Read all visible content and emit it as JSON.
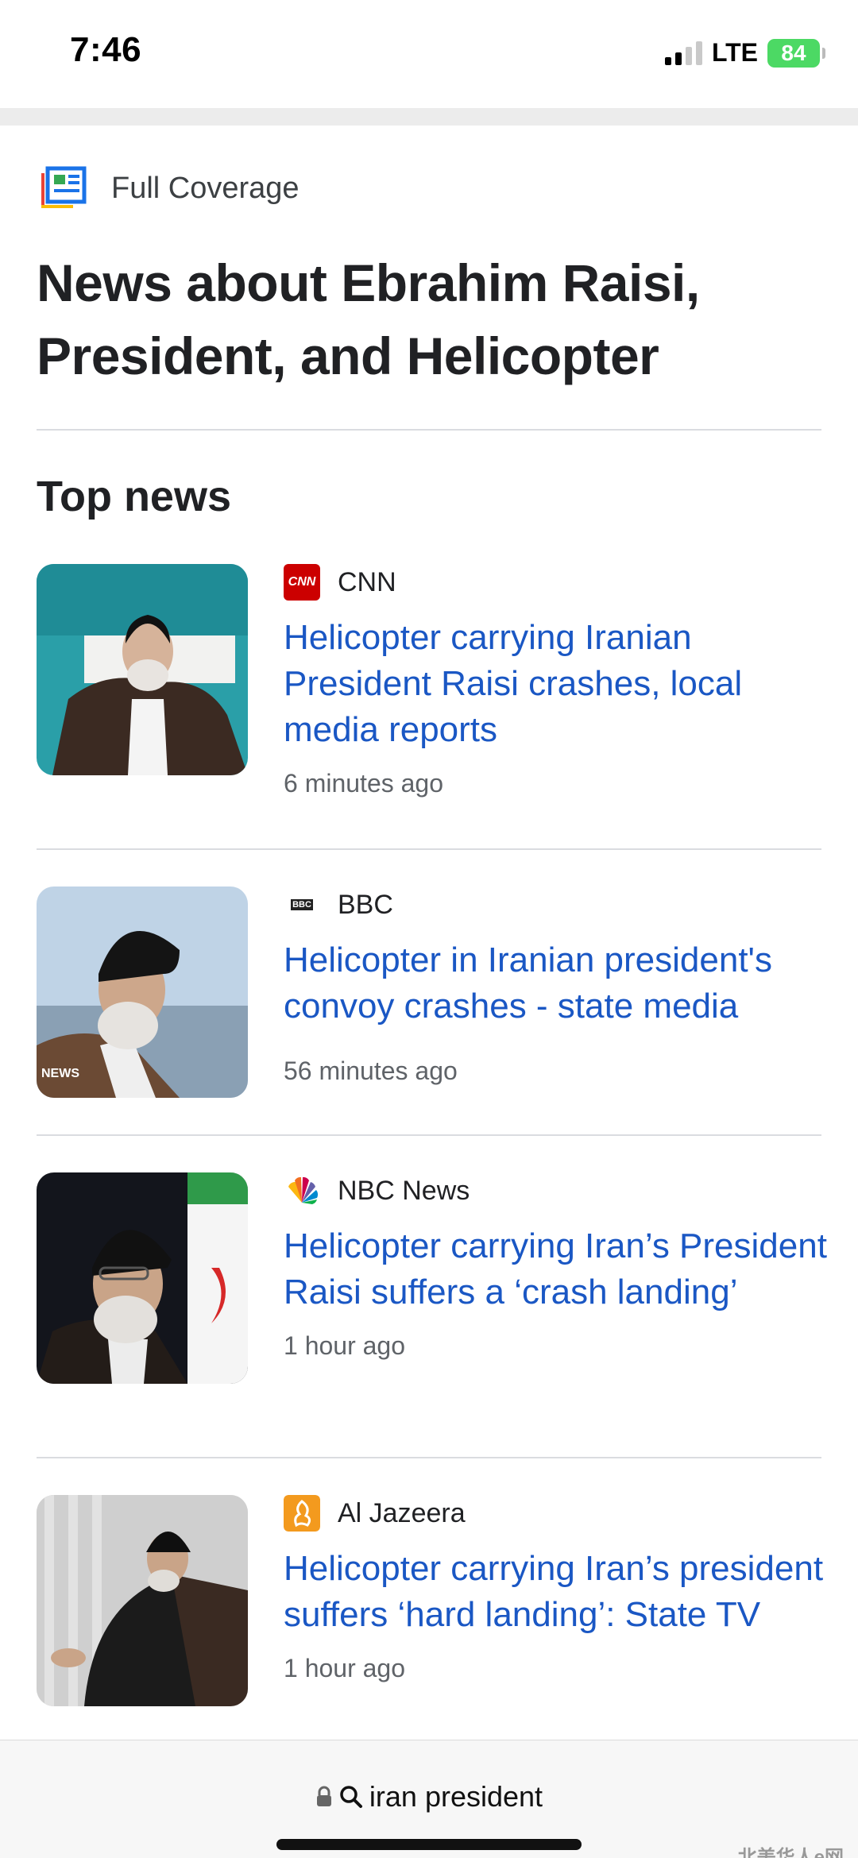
{
  "status_bar": {
    "time": "7:46",
    "network": "LTE",
    "battery": "84"
  },
  "header": {
    "full_coverage_label": "Full Coverage",
    "title": "News about Ebrahim Raisi, President, and Helicopter"
  },
  "section": {
    "title": "Top news"
  },
  "articles": [
    {
      "source": "CNN",
      "source_logo_text": "CNN",
      "headline": "Helicopter carrying Iranian President Raisi crashes, local media reports",
      "time": "6 minutes ago"
    },
    {
      "source": "BBC",
      "source_logo_text": "BBC",
      "headline": "Helicopter in Iranian president's convoy crashes - state media",
      "time": "56 minutes ago",
      "thumb_badge": "NEWS"
    },
    {
      "source": "NBC News",
      "headline": "Helicopter carrying Iran’s President Raisi suffers a ‘crash landing’",
      "time": "1 hour ago"
    },
    {
      "source": "Al Jazeera",
      "headline": "Helicopter carrying Iran’s president suffers ‘hard landing’: State TV",
      "time": "1 hour ago"
    }
  ],
  "browser_bar": {
    "url": "iran president"
  },
  "watermark": "北美华人e网",
  "colors": {
    "headline": "#1a57c4",
    "cnn_red": "#cc0000",
    "aljazeera_orange": "#f39a1e",
    "battery_green": "#4cd964"
  }
}
